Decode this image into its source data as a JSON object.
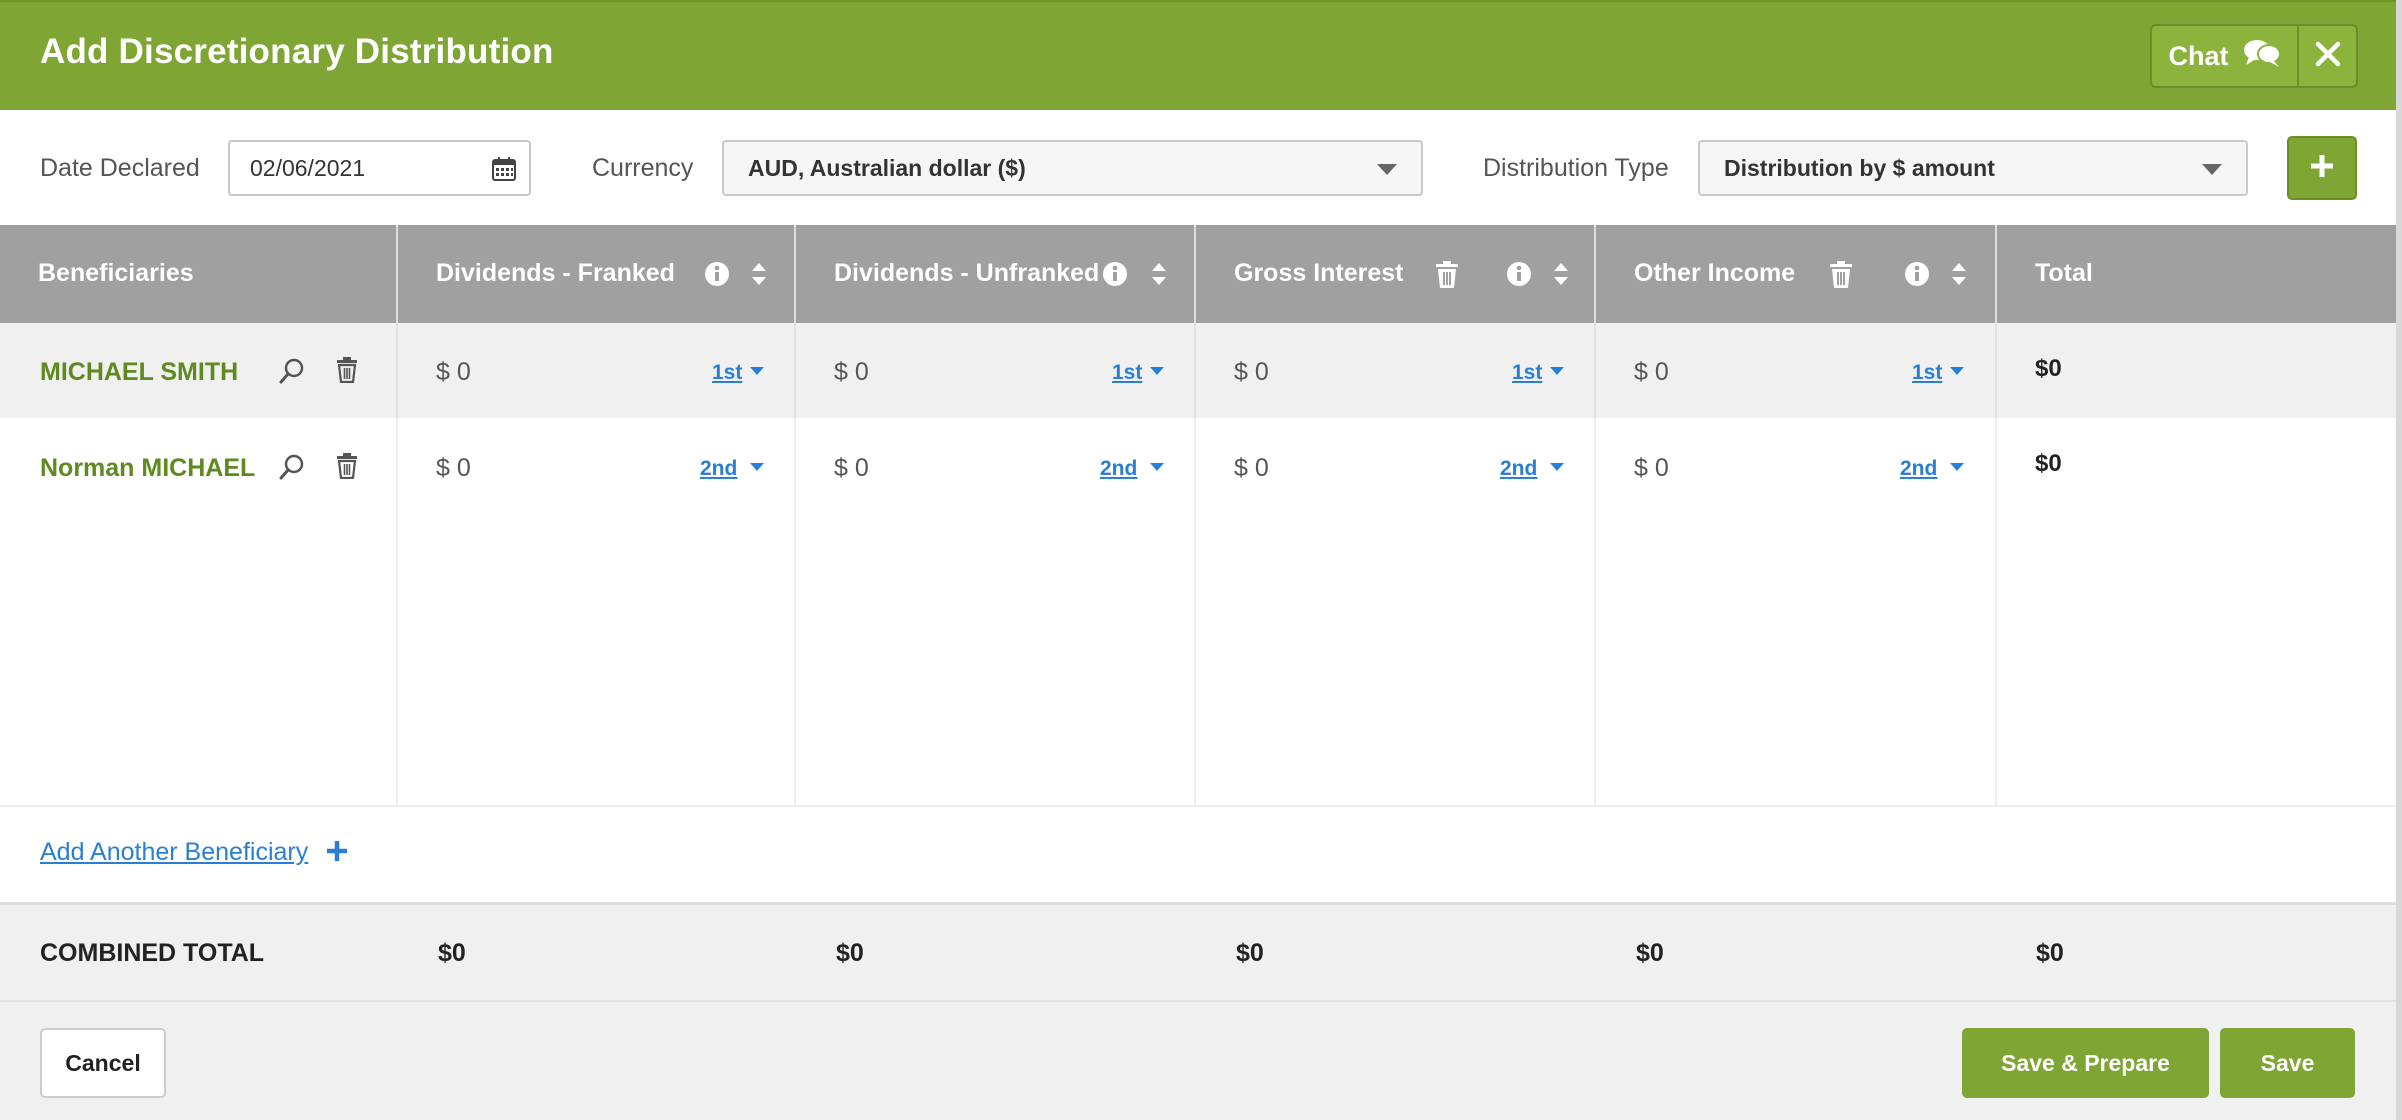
{
  "header": {
    "title": "Add Discretionary Distribution",
    "chat_label": "Chat"
  },
  "toolbar": {
    "date_label": "Date Declared",
    "date_value": "02/06/2021",
    "currency_label": "Currency",
    "currency_value": "AUD, Australian dollar ($)",
    "type_label": "Distribution Type",
    "type_value": "Distribution by $ amount"
  },
  "table": {
    "headers": [
      "Beneficiaries",
      "Dividends - Franked",
      "Dividends - Unfranked",
      "Gross Interest",
      "Other Income",
      "Total"
    ],
    "rows": [
      {
        "name": "MICHAEL SMITH",
        "amounts": [
          "$ 0",
          "$ 0",
          "$ 0",
          "$ 0"
        ],
        "order": "1st",
        "total": "$0"
      },
      {
        "name": "Norman MICHAEL",
        "amounts": [
          "$ 0",
          "$ 0",
          "$ 0",
          "$ 0"
        ],
        "order": "2nd",
        "total": "$0"
      }
    ],
    "add_beneficiary": "Add Another Beneficiary",
    "combined_label": "COMBINED TOTAL",
    "combined_values": [
      "$0",
      "$0",
      "$0",
      "$0",
      "$0"
    ]
  },
  "footer": {
    "cancel": "Cancel",
    "save_prepare": "Save & Prepare",
    "save": "Save"
  },
  "colors": {
    "brand_green": "#7fa634",
    "link_blue": "#2a7fd4",
    "name_green": "#5e8a1f",
    "header_gray": "#a0a0a0"
  }
}
